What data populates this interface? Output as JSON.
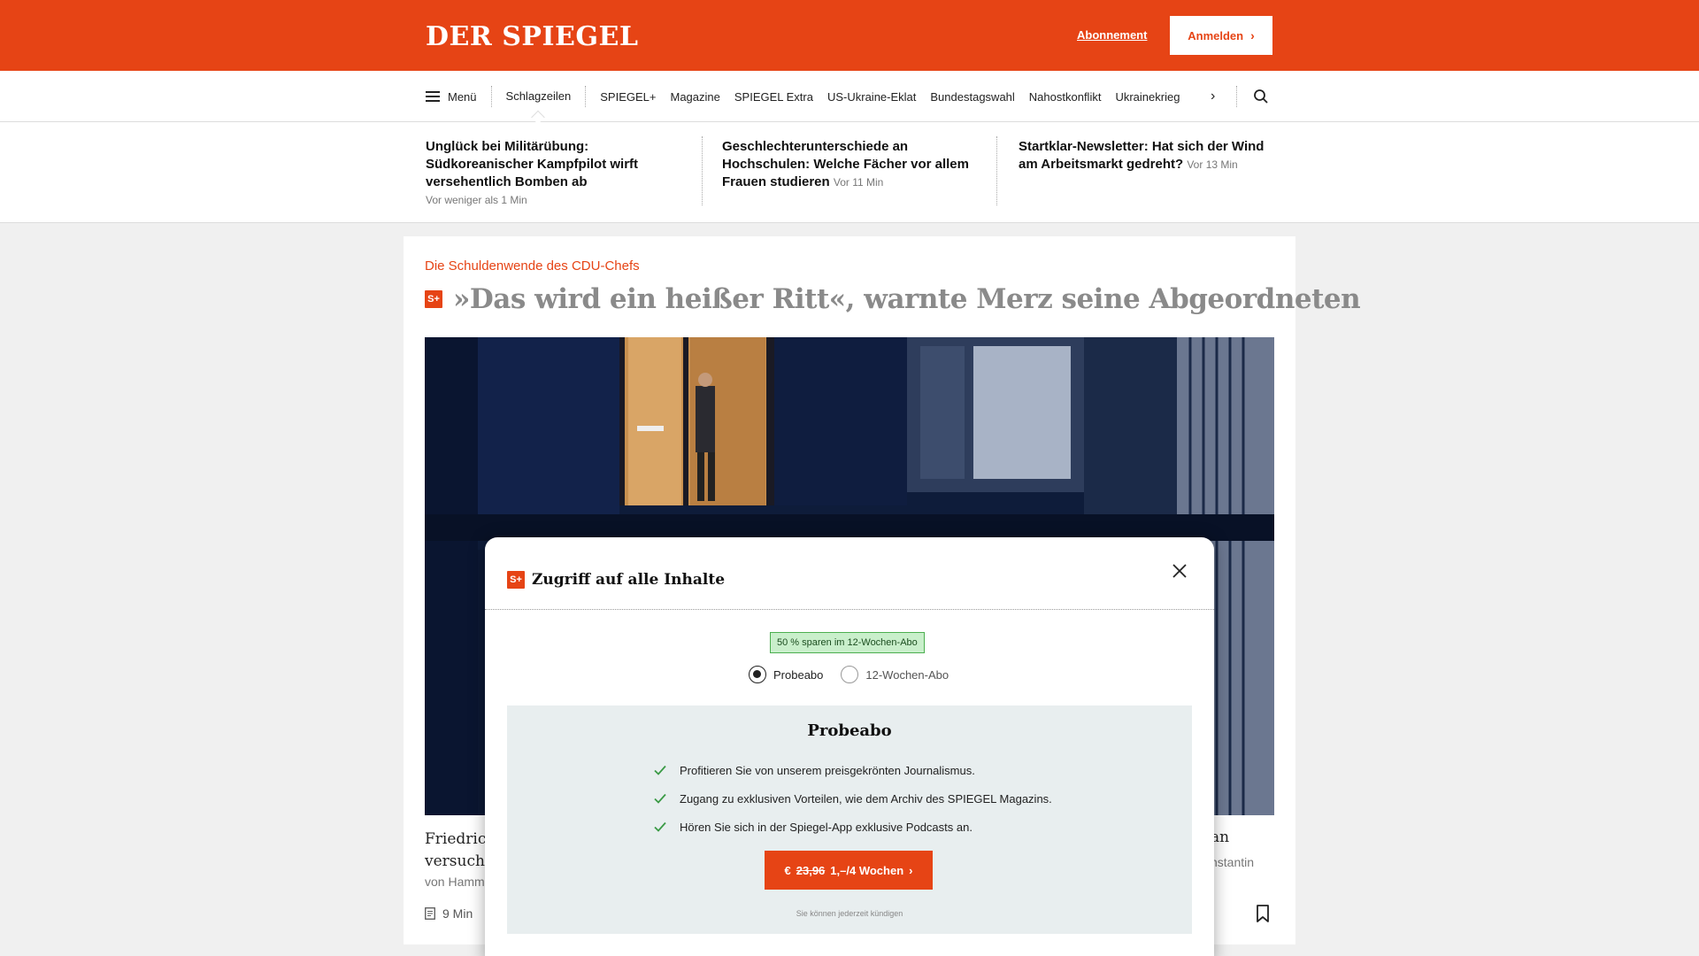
{
  "header": {
    "logo": "DER SPIEGEL",
    "abo_link": "Abonnement",
    "login_label": "Anmelden",
    "brand_color": "#e64415"
  },
  "nav": {
    "menu_label": "Menü",
    "items": [
      "Schlagzeilen",
      "SPIEGEL+",
      "Magazine",
      "SPIEGEL Extra",
      "US-Ukraine-Eklat",
      "Bundestagswahl",
      "Nahostkonflikt",
      "Ukrainekrieg"
    ],
    "active_item": "Schlagzeilen"
  },
  "ticker": [
    {
      "title": "Unglück bei Militärübung: Südkoreanischer Kampfpilot wirft versehentlich Bomben ab",
      "time": "Vor weniger als 1 Min"
    },
    {
      "title": "Geschlechterunterschiede an Hochschulen: Welche Fächer vor allem Frauen studieren",
      "time": "Vor 11 Min"
    },
    {
      "title": "Startklar-Newsletter: Hat sich der Wind am Arbeitsmarkt gedreht?",
      "time": "Vor 13 Min"
    }
  ],
  "article": {
    "kicker": "Die Schuldenwende des CDU-Chefs",
    "badge": "S+",
    "headline": "»Das wird ein heißer Ritt«, warnte Merz seine Abgeordneten",
    "teaser_left_line1": "Friedrich",
    "teaser_left_line2": "versucht",
    "byline_left": "von Hamm",
    "teaser_right": "an",
    "byline_right": "nstantin",
    "readtime": "9 Min"
  },
  "modal": {
    "badge": "S+",
    "title": "Zugriff auf alle Inhalte",
    "save_badge": "50 % sparen im 12-Wochen-Abo",
    "options": [
      "Probeabo",
      "12-Wochen-Abo"
    ],
    "selected_option": "Probeabo",
    "plan_title": "Probeabo",
    "benefits": [
      "Profitieren Sie von unserem preisgekrönten Journalismus.",
      "Zugang zu exklusiven Vorteilen, wie dem Archiv des SPIEGEL Magazins.",
      "Hören Sie sich in der Spiegel-App exklusive Podcasts an."
    ],
    "cta_currency": "€",
    "cta_old_price": "23,96",
    "cta_new_price": "1,–/4 Wochen",
    "cancel_note": "Sie können jederzeit kündigen"
  }
}
